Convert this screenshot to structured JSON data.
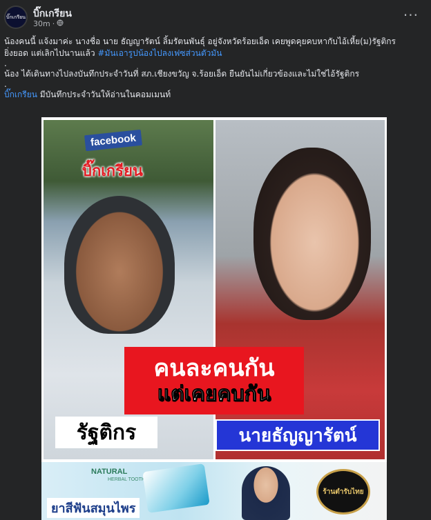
{
  "post": {
    "author": "บิ๊กเกรียน",
    "avatar_text": "บิ๊กเกรียน",
    "time": "30m",
    "dot": "·",
    "privacy_icon": "globe-icon",
    "more": "···"
  },
  "body": {
    "line1": "น้องคนนี้ แจ้งมาค่ะ นางชื่อ นาย ธัญญารัตน์ ลิ้มรัตนพันธุ์ อยู่จังหวัดร้อยเอ็ด เคยพูดคุยคบหากับไอ้เหี้ย(ม)รัฐติกร",
    "line2_text": "ยิ่งยอด แต่เลิกไปนานแล้ว ",
    "line2_hashtag": "#มันเอารูปน้องไปลงเฟซส่วนตัวมัน",
    "sep1": ".",
    "line3": "น้อง ได้เดินทางไปลงบันทึกประจำวันที่ สภ.เชียงขวัญ จ.ร้อยเอ็ด ยืนยันไม่เกี่ยวข้องและไม่ใช่ไอ้รัฐติกร",
    "sep2": ".",
    "line4_link": "บิ๊กเกรียน",
    "line4_text": " มีบันทึกประจำวันให้อ่านในคอมเมนท์"
  },
  "image": {
    "facebook_tag": "facebook",
    "brand_overlay": "บิ๊กเกรียน",
    "caption_line1": "คนละคนกัน",
    "caption_line2": "แต่เคยคบกัน",
    "name_left": "รัฐติกร",
    "name_right": "นายธัญญารัตน์",
    "ad_natural": "NATURAL",
    "ad_sub": "HERBAL TOOTHPASTE",
    "ad_title": "ยาสีฟันสมุนไพร",
    "ad_logo_text": "ร้านตำรับไทย"
  },
  "colors": {
    "background": "#242526",
    "link": "#4599ff",
    "caption_red": "#e8161f",
    "name_blue": "#2436d6"
  }
}
